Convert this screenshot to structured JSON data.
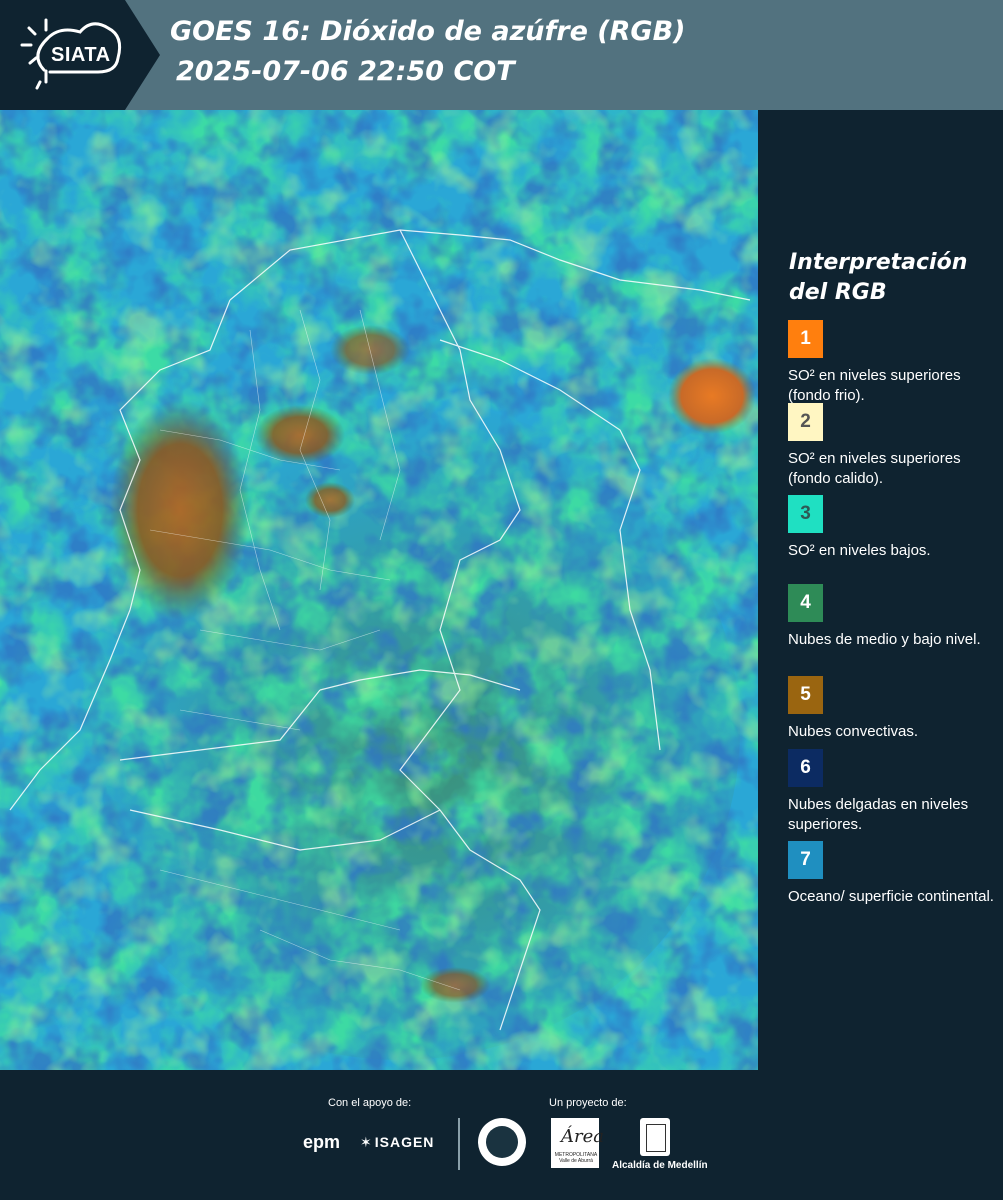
{
  "header": {
    "logo_text": "SIATA",
    "title_line1": "GOES 16: Dióxido de azúfre (RGB)",
    "title_line2": "2025-07-06 22:50 COT"
  },
  "legend": {
    "title": "Interpretación del RGB",
    "items": [
      {
        "number": "1",
        "label": "SO² en niveles superiores (fondo frio).",
        "color": "#ff7f0e"
      },
      {
        "number": "2",
        "label": "SO² en niveles superiores (fondo calido).",
        "color": "#fff6c2"
      },
      {
        "number": "3",
        "label": "SO² en niveles bajos.",
        "color": "#1fe0c2"
      },
      {
        "number": "4",
        "label": "Nubes de medio y bajo nivel.",
        "color": "#2e8b57"
      },
      {
        "number": "5",
        "label": "Nubes convectivas.",
        "color": "#9a6510"
      },
      {
        "number": "6",
        "label": "Nubes delgadas en niveles superiores.",
        "color": "#0c2b62"
      },
      {
        "number": "7",
        "label": "Oceano/ superficie continental.",
        "color": "#1f8fc0"
      }
    ]
  },
  "footer": {
    "support_label": "Con el apoyo de:",
    "project_label": "Un proyecto de:",
    "epm": "epm",
    "isagen": "ISAGEN",
    "area_script": "Área",
    "area_sub": "METROPOLITANA Valle de Aburrá",
    "alcaldia": "Alcaldía de Medellín"
  },
  "colors": {
    "header_bg": "#52727f",
    "panel_bg": "#0f2330",
    "ocean": "#2aa7d6"
  }
}
